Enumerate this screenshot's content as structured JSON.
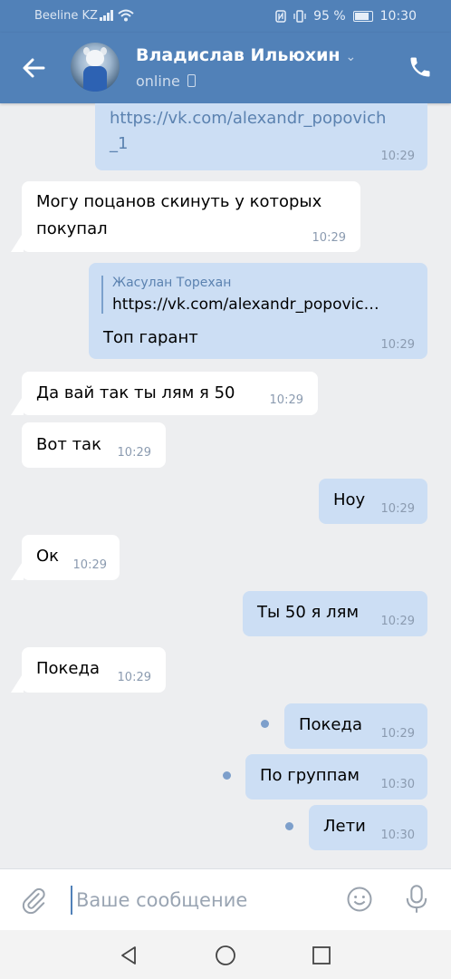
{
  "status": {
    "carrier": "Beeline KZ",
    "battery": "95 %",
    "time": "10:30"
  },
  "header": {
    "name": "Владислав Ильюхин",
    "status": "online"
  },
  "messages": [
    {
      "text_line1": "https://vk.com/alexandr_popovich",
      "text_line2": "_1",
      "time": "10:29"
    },
    {
      "text_line1": "Могу поцанов скинуть у которых",
      "text_line2": "покупал",
      "time": "10:29"
    },
    {
      "quote_name": "Жасулан Торехан",
      "quote_link": "https://vk.com/alexandr_popovic…",
      "text": "Топ гарант",
      "time": "10:29"
    },
    {
      "text": "Да вай так ты  лям я 50",
      "time": "10:29"
    },
    {
      "text": "Вот так",
      "time": "10:29"
    },
    {
      "text": "Ноу",
      "time": "10:29"
    },
    {
      "text": "Ок",
      "time": "10:29"
    },
    {
      "text": "Ты 50 я лям",
      "time": "10:29"
    },
    {
      "text": "Покеда",
      "time": "10:29"
    },
    {
      "text": "Покеда",
      "time": "10:29"
    },
    {
      "text": "По группам",
      "time": "10:30"
    },
    {
      "text": "Лети",
      "time": "10:30"
    }
  ],
  "composer": {
    "placeholder": "Ваше сообщение"
  }
}
